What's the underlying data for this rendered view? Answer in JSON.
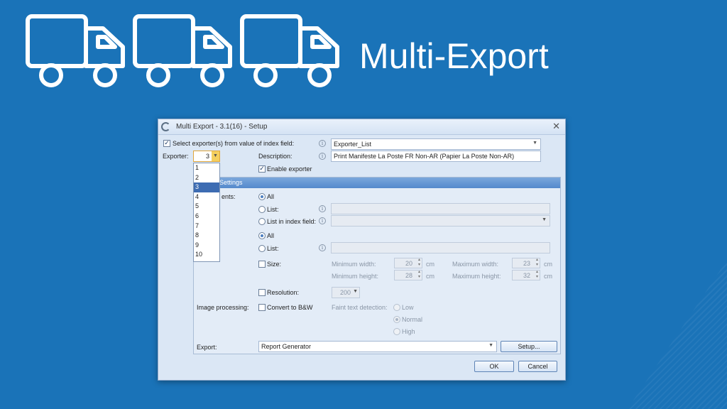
{
  "slide": {
    "title": "Multi-Export"
  },
  "dialog": {
    "title": "Multi Export - 3.1(16) - Setup",
    "select_exporters_label": "Select exporter(s) from value of index field:",
    "index_field_value": "Exporter_List",
    "exporter_label": "Exporter:",
    "exporter_value": "3",
    "exporter_options": [
      "1",
      "2",
      "3",
      "4",
      "5",
      "6",
      "7",
      "8",
      "9",
      "10"
    ],
    "description_label": "Description:",
    "description_value": "Print Manifeste La Poste FR Non-AR (Papier La Poste Non-AR)",
    "enable_exporter_label": "Enable exporter",
    "settings_header": "Settings",
    "documents_label": "ents:",
    "documents_all": "All",
    "documents_list": "List:",
    "documents_list_index": "List in index field:",
    "pages_all": "All",
    "pages_list": "List:",
    "size_label": "Size:",
    "min_width_label": "Minimum width:",
    "min_width_value": "20",
    "min_height_label": "Minimum height:",
    "min_height_value": "28",
    "max_width_label": "Maximum width:",
    "max_width_value": "23",
    "max_height_label": "Maximum height:",
    "max_height_value": "32",
    "unit": "cm",
    "resolution_label": "Resolution:",
    "resolution_value": "200",
    "image_processing_label": "Image processing:",
    "convert_bw_label": "Convert to B&W",
    "faint_text_label": "Faint text detection:",
    "faint_low": "Low",
    "faint_normal": "Normal",
    "faint_high": "High",
    "export_label": "Export:",
    "export_value": "Report Generator",
    "setup_button": "Setup...",
    "ok_button": "OK",
    "cancel_button": "Cancel"
  }
}
